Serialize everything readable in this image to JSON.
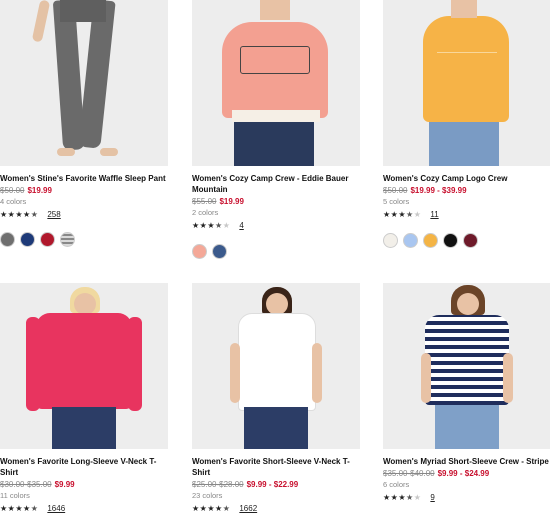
{
  "products": [
    {
      "title": "Women's Stine's Favorite Waffle Sleep Pant",
      "price_old": "$50.00",
      "price_new": "$19.99",
      "colors": "4 colors",
      "stars": 4.5,
      "reviews": "258",
      "swatches": [
        "#6f6f6f",
        "#1e3a78",
        "#b0182c",
        "#d9d9d9"
      ],
      "garment_color": "#6a6a6a"
    },
    {
      "title": "Women's Cozy Camp Crew - Eddie Bauer Mountain",
      "price_old": "$55.00",
      "price_new": "$19.99",
      "colors": "2 colors",
      "stars": 3.5,
      "reviews": "4",
      "swatches": [
        "#f4a898",
        "#3b5a8c"
      ],
      "garment_color": "#f3a091"
    },
    {
      "title": "Women's Cozy Camp Logo Crew",
      "price_old": "$50.00",
      "price_new": "$19.99 - $39.99",
      "colors": "5 colors",
      "stars": 3.5,
      "reviews": "11",
      "swatches": [
        "#f2efe9",
        "#a9c6f0",
        "#f4b445",
        "#111111",
        "#6e1a2a"
      ],
      "garment_color": "#f6b347"
    },
    {
      "title": "Women's Favorite Long-Sleeve V-Neck T-Shirt",
      "price_old": "$30.00-$35.00",
      "price_new": "$9.99",
      "colors": "11 colors",
      "stars": 4.5,
      "reviews": "1646",
      "swatches": [],
      "garment_color": "#e8345f"
    },
    {
      "title": "Women's Favorite Short-Sleeve V-Neck T-Shirt",
      "price_old": "$25.00-$28.00",
      "price_new": "$9.99 - $22.99",
      "colors": "23 colors",
      "stars": 4.5,
      "reviews": "1662",
      "swatches": [],
      "garment_color": "#ffffff"
    },
    {
      "title": "Women's Myriad Short-Sleeve Crew - Stripe",
      "price_old": "$35.00-$40.00",
      "price_new": "$9.99 - $24.99",
      "colors": "6 colors",
      "stars": 3.5,
      "reviews": "9",
      "swatches": [],
      "garment_color": "#1f2d5c"
    }
  ]
}
